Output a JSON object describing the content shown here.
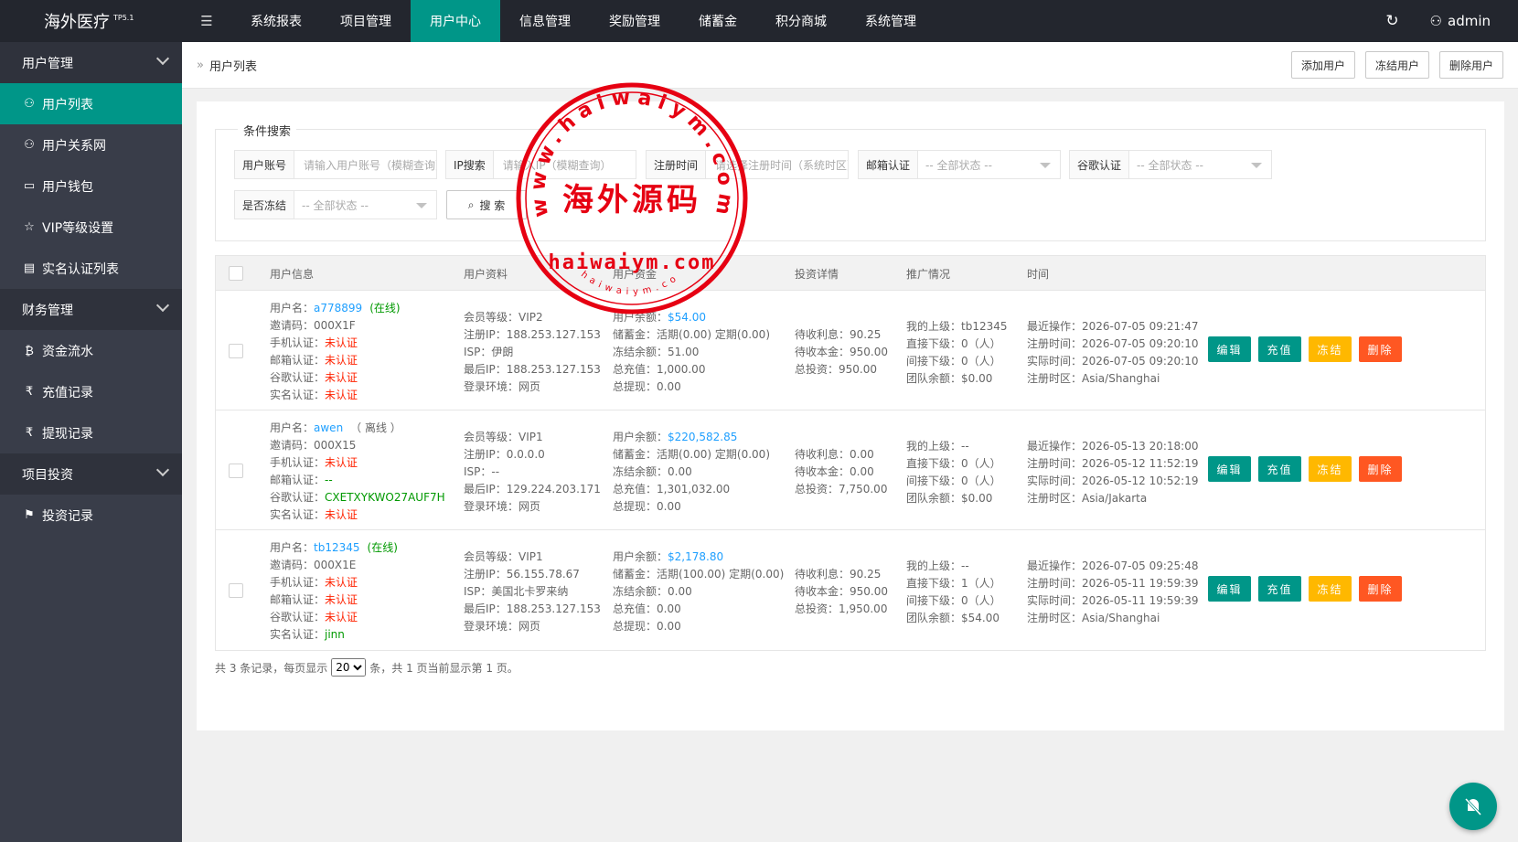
{
  "brand": {
    "name": "海外医疗",
    "version": "TP5.1"
  },
  "topnav": [
    "系统报表",
    "项目管理",
    "用户中心",
    "信息管理",
    "奖励管理",
    "储蓄金",
    "积分商城",
    "系统管理"
  ],
  "topnav_active": "用户中心",
  "admin": "admin",
  "sidebar": {
    "group_user": "用户管理",
    "user_items": [
      "用户列表",
      "用户关系网",
      "用户钱包",
      "VIP等级设置",
      "实名认证列表"
    ],
    "group_finance": "财务管理",
    "finance_items": [
      "资金流水",
      "充值记录",
      "提现记录"
    ],
    "group_invest": "项目投资",
    "invest_items": [
      "投资记录"
    ]
  },
  "breadcrumb": "用户列表",
  "top_buttons": {
    "add": "添加用户",
    "freeze": "冻结用户",
    "delete": "删除用户"
  },
  "search": {
    "legend": "条件搜索",
    "account_label": "用户账号",
    "account_placeholder": "请输入用户账号（模糊查询）",
    "ip_label": "IP搜索",
    "ip_placeholder": "请输入IP（模糊查询）",
    "regtime_label": "注册时间",
    "regtime_placeholder": "请选择注册时间（系统时区）",
    "email_label": "邮箱认证",
    "email_value": "-- 全部状态 --",
    "google_label": "谷歌认证",
    "google_value": "-- 全部状态 --",
    "frozen_label": "是否冻结",
    "frozen_value": "-- 全部状态 --",
    "button": "搜 索"
  },
  "table": {
    "headers": [
      "用户信息",
      "用户资料",
      "用户资金",
      "投资详情",
      "推广情况",
      "时间"
    ],
    "rows": [
      {
        "username": "a778899",
        "status": "(在线)",
        "invite": "000X1F",
        "phone": "未认证",
        "email": "未认证",
        "google": "未认证",
        "realname": "未认证",
        "vip": "VIP2",
        "reg_ip": "188.253.127.153",
        "isp": "伊朗",
        "last_ip": "188.253.127.153",
        "env": "网页",
        "balance": "$54.00",
        "savings": "活期(0.00) 定期(0.00)",
        "frozen": "51.00",
        "recharge": "1,000.00",
        "withdraw": "0.00",
        "pending_interest": "90.25",
        "pending_principal": "950.00",
        "total_invest": "950.00",
        "superior": "tb12345",
        "direct": "0（人）",
        "indirect": "0（人）",
        "team": "$0.00",
        "last_op": "2026-07-05 09:21:47",
        "reg_time": "2026-07-05 09:20:10",
        "real_time": "2026-07-05 09:20:10",
        "tz": "Asia/Shanghai"
      },
      {
        "username": "awen",
        "status": "（ 离线 ）",
        "invite": "000X15",
        "phone": "未认证",
        "email": "--",
        "google": "CXETXYKWO27AUF7H",
        "realname": "未认证",
        "vip": "VIP1",
        "reg_ip": "0.0.0.0",
        "isp": "--",
        "last_ip": "129.224.203.171",
        "env": "网页",
        "balance": "$220,582.85",
        "savings": "活期(0.00) 定期(0.00)",
        "frozen": "0.00",
        "recharge": "1,301,032.00",
        "withdraw": "0.00",
        "pending_interest": "0.00",
        "pending_principal": "0.00",
        "total_invest": "7,750.00",
        "superior": "--",
        "direct": "0（人）",
        "indirect": "0（人）",
        "team": "$0.00",
        "last_op": "2026-05-13 20:18:00",
        "reg_time": "2026-05-12 11:52:19",
        "real_time": "2026-05-12 10:52:19",
        "tz": "Asia/Jakarta"
      },
      {
        "username": "tb12345",
        "status": "(在线)",
        "invite": "000X1E",
        "phone": "未认证",
        "email": "未认证",
        "google": "未认证",
        "realname": "jinn",
        "vip": "VIP1",
        "reg_ip": "56.155.78.67",
        "isp": "美国北卡罗来纳",
        "last_ip": "188.253.127.153",
        "env": "网页",
        "balance": "$2,178.80",
        "savings": "活期(100.00) 定期(0.00)",
        "frozen": "0.00",
        "recharge": "0.00",
        "withdraw": "0.00",
        "pending_interest": "90.25",
        "pending_principal": "950.00",
        "total_invest": "1,950.00",
        "superior": "--",
        "direct": "1（人）",
        "indirect": "0（人）",
        "team": "$54.00",
        "last_op": "2026-07-05 09:25:48",
        "reg_time": "2026-05-11 19:59:39",
        "real_time": "2026-05-11 19:59:39",
        "tz": "Asia/Shanghai"
      }
    ],
    "labels": {
      "username": "用户名：",
      "invite": "邀请码：",
      "phone": "手机认证：",
      "email": "邮箱认证：",
      "google": "谷歌认证：",
      "realname": "实名认证：",
      "vip": "会员等级：",
      "reg_ip": "注册IP：",
      "isp": "ISP：",
      "last_ip": "最后IP：",
      "env": "登录环境：",
      "balance": "用户余额：",
      "savings": "储蓄金：",
      "frozen": "冻结余额：",
      "recharge": "总充值：",
      "withdraw": "总提现：",
      "pending_interest": "待收利息：",
      "pending_principal": "待收本金：",
      "total_invest": "总投资：",
      "superior": "我的上级：",
      "direct": "直接下级：",
      "indirect": "间接下级：",
      "team": "团队余额：",
      "last_op": "最近操作：",
      "reg_time": "注册时间：",
      "real_time": "实际时间：",
      "tz": "注册时区："
    },
    "actions": {
      "edit": "编辑",
      "recharge": "充值",
      "freeze": "冻结",
      "delete": "删除"
    }
  },
  "pager": {
    "prefix": "共 3 条记录，每页显示",
    "per_page": "20",
    "suffix": "条，共 1 页当前显示第 1 页。"
  },
  "watermark": {
    "ring_text": "www.haiwaiym.com",
    "center": "海外源码",
    "domain": "haiwaiym.com",
    "small": "haiwaiym.com"
  },
  "colors": {
    "accent": "#009688",
    "orange": "#ffb800",
    "red": "#ff5722",
    "link": "#1e9fff",
    "stamp": "#e60012"
  }
}
